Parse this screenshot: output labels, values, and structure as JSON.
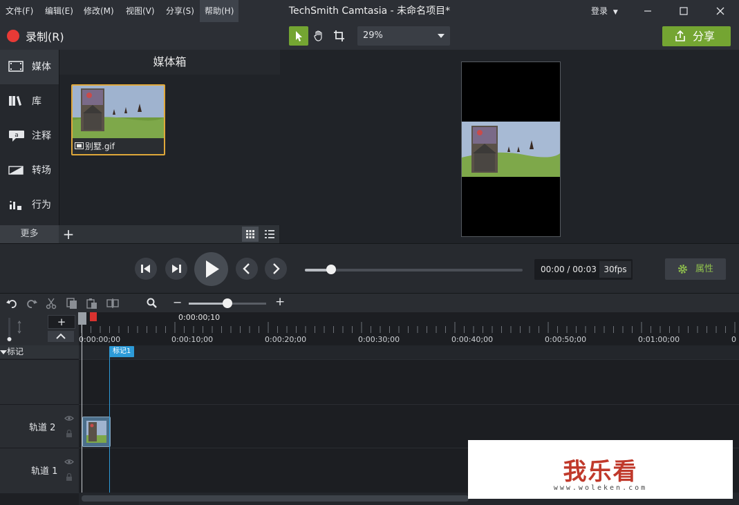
{
  "menu": {
    "file": "文件(F)",
    "edit": "编辑(E)",
    "modify": "修改(M)",
    "view": "视图(V)",
    "share": "分享(S)",
    "help": "帮助(H)"
  },
  "app_title": "TechSmith Camtasia - 未命名项目*",
  "login": "登录",
  "record_label": "录制(R)",
  "zoom_value": "29%",
  "share_button": "分享",
  "nav": {
    "media": "媒体",
    "library": "库",
    "annotations": "注释",
    "transitions": "转场",
    "behaviors": "行为",
    "more": "更多"
  },
  "media_bin": {
    "title": "媒体箱",
    "file_name": "别墅.gif"
  },
  "transport": {
    "time": "00:00 / 00:03",
    "fps": "30fps",
    "properties": "属性",
    "progress": 0.12
  },
  "timeline": {
    "zoom_level": 0.5,
    "playhead_time": "0:00:00;10",
    "ticks": [
      "0:00:00;00",
      "0:00:10;00",
      "0:00:20;00",
      "0:00:30;00",
      "0:00:40;00",
      "0:00:50;00",
      "0:01:00;00",
      "0"
    ],
    "markers_label": "标记",
    "marker_tag": "标记1",
    "tracks": [
      "轨道 2",
      "轨道 1"
    ]
  },
  "watermark": {
    "text": "我乐看",
    "url": "www.woleken.com"
  },
  "colors": {
    "accent_green": "#74a532",
    "record_red": "#e83a36",
    "marker_blue": "#2d9bd8",
    "selection_orange": "#e0a83a"
  }
}
